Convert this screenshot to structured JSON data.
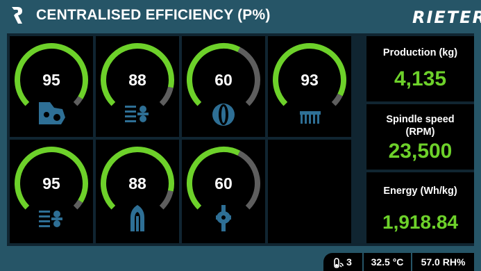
{
  "header": {
    "title": "CENTRALISED EFFICIENCY (P%)",
    "brand": "RIETER"
  },
  "gauges": [
    {
      "value": 95,
      "icon": "blowroom-machine-icon"
    },
    {
      "value": 88,
      "icon": "carding-machine-icon"
    },
    {
      "value": 60,
      "icon": "roving-bobbin-icon"
    },
    {
      "value": 93,
      "icon": "comber-icon"
    },
    {
      "value": 95,
      "icon": "draw-frame-icon"
    },
    {
      "value": 88,
      "icon": "spinning-cop-icon"
    },
    {
      "value": 60,
      "icon": "spindle-icon"
    }
  ],
  "stats": {
    "production": {
      "label": "Production (kg)",
      "value": "4,135"
    },
    "spindle": {
      "label_line1": "Spindle speed",
      "label_line2": "(RPM)",
      "value": "23,500"
    },
    "energy": {
      "label": "Energy (Wh/kg)",
      "value": "1,918.84"
    }
  },
  "footer": {
    "alarm_count": "3",
    "temperature": "32.5 °C",
    "humidity": "57.0 RH%",
    "alarm_icon": "fan-alarm-icon"
  },
  "colors": {
    "accent_green": "#6dd12a",
    "track_grey": "#5e5e5e",
    "header_teal": "#265567",
    "icon_blue": "#2e6f95"
  }
}
